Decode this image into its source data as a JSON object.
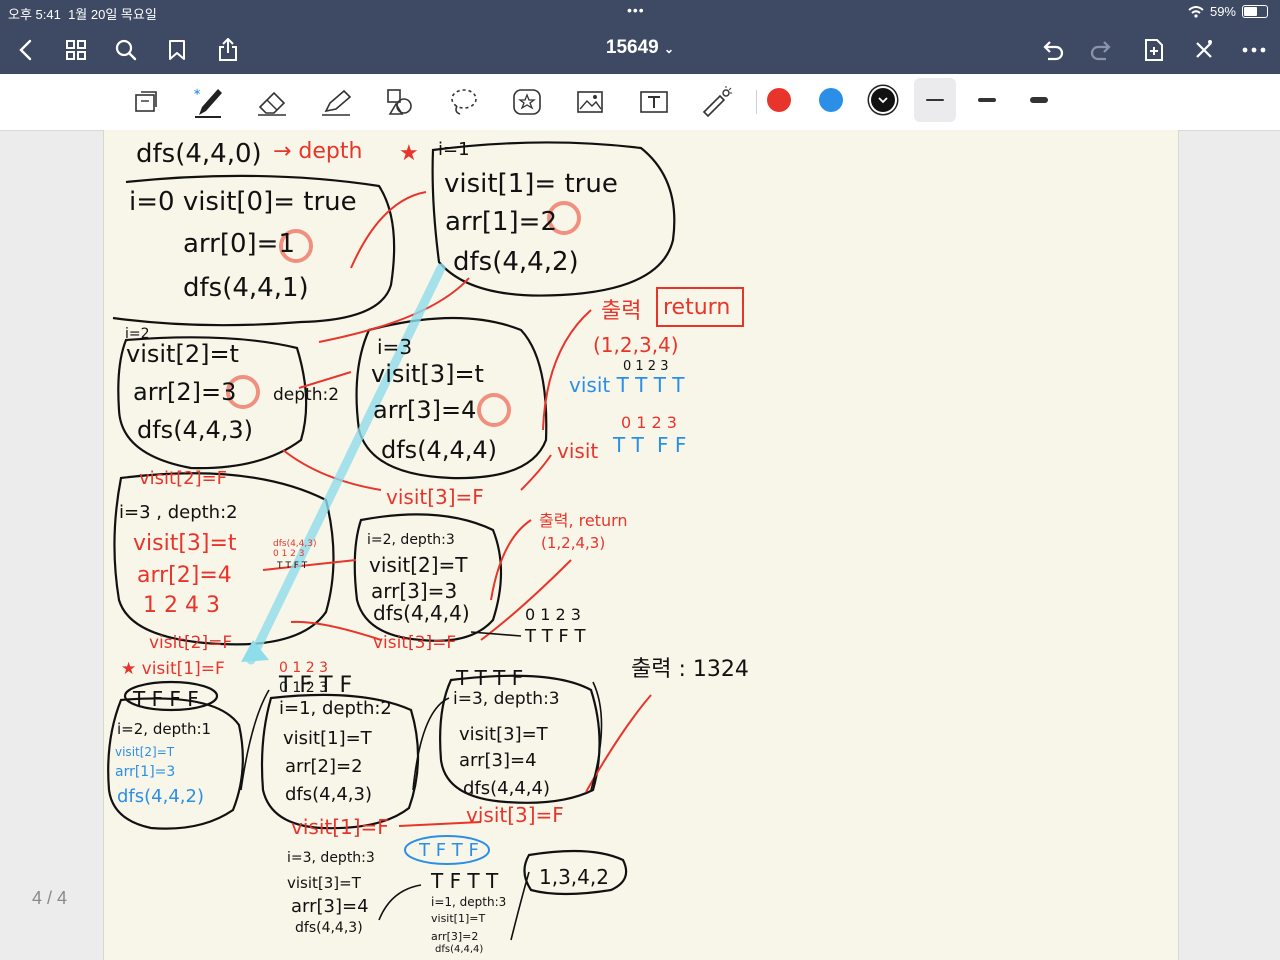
{
  "status_bar": {
    "time": "오후 5:41",
    "date": "1월 20일 목요일",
    "battery": "59%",
    "battery_level": 0.59
  },
  "nav": {
    "title": "15649"
  },
  "page_indicator": "4 / 4",
  "colors": {
    "red": "#e8352b",
    "blue": "#2b8fe8",
    "black": "#111111",
    "nav_bg": "#3e4a64",
    "paper": "#f8f6e9"
  },
  "toolbar": {
    "tools": [
      "read-only-icon",
      "pen-icon",
      "eraser-icon",
      "highlighter-icon",
      "shapes-icon",
      "lasso-icon",
      "sticker-icon",
      "image-icon",
      "text-icon",
      "laser-pointer-icon"
    ],
    "swatches": [
      "#e8352b",
      "#2b8fe8",
      "#111111"
    ]
  },
  "notes": [
    "dfs(4,4,0)",
    "→ depth",
    "★",
    "i=1",
    "visit[1]= true",
    "arr[1]=2",
    "dfs(4,4,2)",
    "i=0 visit[0]= true",
    "arr[0]=1",
    "dfs(4,4,1)",
    "출력",
    "return",
    "(1,2,3,4)",
    "0 1 2 3",
    "visit T T T T",
    "i=2",
    "visit[2]=t",
    "arr[2]=3",
    "depth:2",
    "dfs(4,4,3)",
    "i=3",
    "visit[3]=t",
    "arr[3]=4",
    "dfs(4,4,4)",
    "0 1 2 3",
    "visit",
    "T T",
    "F F",
    "visit[3]=F",
    "visit[2]=F",
    "i=3 , depth:2",
    "visit[3]=t",
    "arr[2]=4",
    "dfs(4,4,3)",
    "0 1 2 3",
    "T T F T",
    "1 2 4 3",
    "i=2, depth:3",
    "visit[2]=T",
    "arr[3]=3",
    "dfs(4,4,4)",
    "출력, return",
    "(1,2,4,3)",
    "0 1 2 3",
    "T T F T",
    "visit[3]=F",
    "visit[2]=F",
    "★ visit[1]=F",
    "0 1 2 3",
    "T F F F",
    "i=2, depth:1",
    "visit[2]=T",
    "arr[1]=3",
    "dfs(4,4,2)",
    "0 1 2 3",
    "T F T F",
    "i=1, depth:2",
    "visit[1]=T",
    "arr[2]=2",
    "dfs(4,4,3)",
    "T T T F",
    "i=3, depth:3",
    "visit[3]=T",
    "arr[3]=4",
    "dfs(4,4,4)",
    "출력 : 1324",
    "visit[1]=F",
    "visit[3]=F",
    "i=3, depth:3",
    "T F T F",
    "visit[3]=T",
    "arr[3]=4",
    "dfs(4,4,3)",
    "T F T T",
    "i=1, depth:3",
    "visit[1]=T",
    "arr[3]=2",
    "dfs(4,4,4)",
    "1,3,4,2"
  ]
}
